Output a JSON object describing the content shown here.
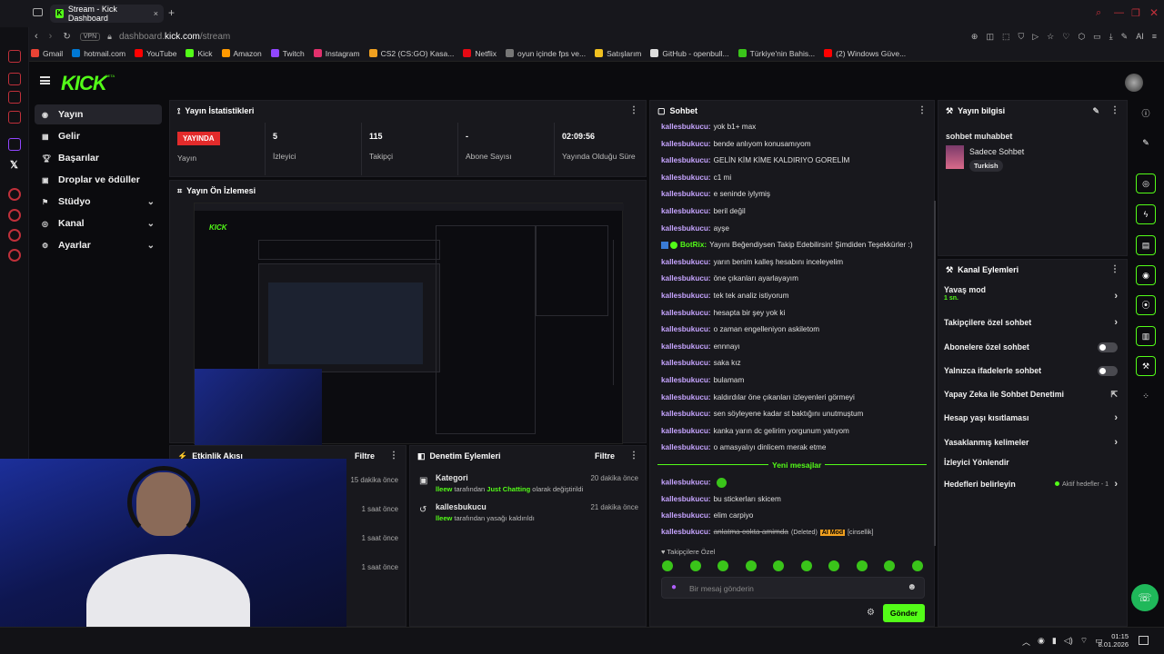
{
  "browser": {
    "tab_title": "Stream - Kick Dashboard",
    "url_host": "dashboard.",
    "url_domain": "kick.com",
    "url_path": "/stream",
    "vpn": "VPN",
    "bookmarks": [
      "Gmail",
      "hotmail.com",
      "YouTube",
      "Kick",
      "Amazon",
      "Twitch",
      "Instagram",
      "CS2 (CS:GO) Kasa...",
      "Netflix",
      "oyun içinde fps ve...",
      "Satışlarım",
      "GitHub - openbull...",
      "Türkiye'nin Bahis...",
      "(2) Windows Güve..."
    ]
  },
  "brand": {
    "logo": "KICK",
    "beta": "BETA"
  },
  "nav": {
    "items": [
      {
        "label": "Yayın",
        "icon": "broadcast-icon"
      },
      {
        "label": "Gelir",
        "icon": "money-icon"
      },
      {
        "label": "Başarılar",
        "icon": "trophy-icon"
      },
      {
        "label": "Droplar ve ödüller",
        "icon": "gift-icon"
      },
      {
        "label": "Stüdyo",
        "icon": "studio-icon"
      },
      {
        "label": "Kanal",
        "icon": "channel-icon"
      },
      {
        "label": "Ayarlar",
        "icon": "gear-icon"
      }
    ]
  },
  "stats": {
    "title": "Yayın İstatistikleri",
    "live_badge": "YAYINDA",
    "live_label": "Yayın",
    "items": [
      {
        "value": "5",
        "label": "İzleyici"
      },
      {
        "value": "115",
        "label": "Takipçi"
      },
      {
        "value": "-",
        "label": "Abone Sayısı"
      },
      {
        "value": "02:09:56",
        "label": "Yayında Olduğu Süre"
      }
    ]
  },
  "preview": {
    "title": "Yayın Ön İzlemesi"
  },
  "activity": {
    "title": "Etkinlik Akışı",
    "filter": "Filtre",
    "times": [
      "15 dakika önce",
      "1 saat önce",
      "1 saat önce",
      "1 saat önce"
    ]
  },
  "moderation": {
    "title": "Denetim Eylemleri",
    "filter": "Filtre",
    "items": [
      {
        "title": "Kategori",
        "user": "lleew",
        "text": " tarafından ",
        "highlight": "Just Chatting",
        "suffix": " olarak değiştirildi",
        "time": "20 dakika önce"
      },
      {
        "title": "kallesbukucu",
        "user": "lleew",
        "text": " tarafından yasağı kaldırıldı",
        "highlight": "",
        "suffix": "",
        "time": "21 dakika önce"
      }
    ]
  },
  "chat": {
    "title": "Sohbet",
    "messages": [
      {
        "user": "kallesbukucu:",
        "text": "yok b1+ max"
      },
      {
        "user": "kallesbukucu:",
        "text": "bende anlıyom konusamıyom"
      },
      {
        "user": "kallesbukucu:",
        "text": "GELİN KİM KİME KALDIRIYO GORELİM"
      },
      {
        "user": "kallesbukucu:",
        "text": "c1 mi"
      },
      {
        "user": "kallesbukucu:",
        "text": "e seninde iylymiş"
      },
      {
        "user": "kallesbukucu:",
        "text": "beril değil"
      },
      {
        "user": "kallesbukucu:",
        "text": "ayşe"
      },
      {
        "user": "BotRix:",
        "text": "Yayını Beğendiysen Takip Edebilirsin! Şimdiden Teşekkürler :)"
      },
      {
        "user": "kallesbukucu:",
        "text": "yarın benim kalleş hesabını inceleyelim"
      },
      {
        "user": "kallesbukucu:",
        "text": "öne çıkanları ayarlayayım"
      },
      {
        "user": "kallesbukucu:",
        "text": "tek tek analiz istiyorum"
      },
      {
        "user": "kallesbukucu:",
        "text": "hesapta bir şey yok ki"
      },
      {
        "user": "kallesbukucu:",
        "text": "o zaman engelleniyon askiletom"
      },
      {
        "user": "kallesbukucu:",
        "text": "ennnayı"
      },
      {
        "user": "kallesbukucu:",
        "text": "saka kız"
      },
      {
        "user": "kallesbukucu:",
        "text": "bulamam"
      },
      {
        "user": "kallesbukucu:",
        "text": "kaldırdılar öne çıkanları izleyenleri görmeyi"
      },
      {
        "user": "kallesbukucu:",
        "text": "sen söyleyene kadar st baktığını unutmuştum"
      },
      {
        "user": "kallesbukucu:",
        "text": "kanka yarın dc gelirim yorgunum yatıyom"
      },
      {
        "user": "kallesbukucu:",
        "text": "o amasyalıyı dinlicem merak etme"
      }
    ],
    "new_divider": "Yeni mesajlar",
    "new_messages": [
      {
        "user": "kallesbukucu:",
        "text": ""
      },
      {
        "user": "kallesbukucu:",
        "text": "bu stickerları skicem"
      },
      {
        "user": "kallesbukucu:",
        "text": "elim carpiyo"
      }
    ],
    "deleted": {
      "user": "kallesbukucu:",
      "text": "anlatma cokta amimda",
      "tag": "(Deleted)",
      "badge": "AI Mod",
      "reason": "[cinsellik]"
    },
    "followers_only": "Takipçilere Özel",
    "placeholder": "Bir mesaj gönderin",
    "send": "Gönder"
  },
  "info": {
    "title": "Yayın bilgisi",
    "stream_title": "sohbet muhabbet",
    "category": "Sadece Sohbet",
    "tag": "Turkish"
  },
  "channel_actions": {
    "title": "Kanal Eylemleri",
    "slow_mode": "Yavaş mod",
    "slow_value": "1 sn.",
    "items": [
      "Takipçilere özel sohbet",
      "Abonelere özel sohbet",
      "Yalnızca ifadelerle sohbet",
      "Yapay Zeka ile Sohbet Denetimi",
      "Hesap yaşı kısıtlaması",
      "Yasaklanmış kelimeler",
      "İzleyici Yönlendir",
      "Hedefleri belirleyin"
    ],
    "goals_status": "Aktif hedefler - 1"
  },
  "taskbar": {
    "time": "01:15",
    "date": "8.01.2026"
  },
  "colors": {
    "accent": "#53fc18",
    "live": "#e32b2b",
    "username": "#c6a4ff"
  }
}
